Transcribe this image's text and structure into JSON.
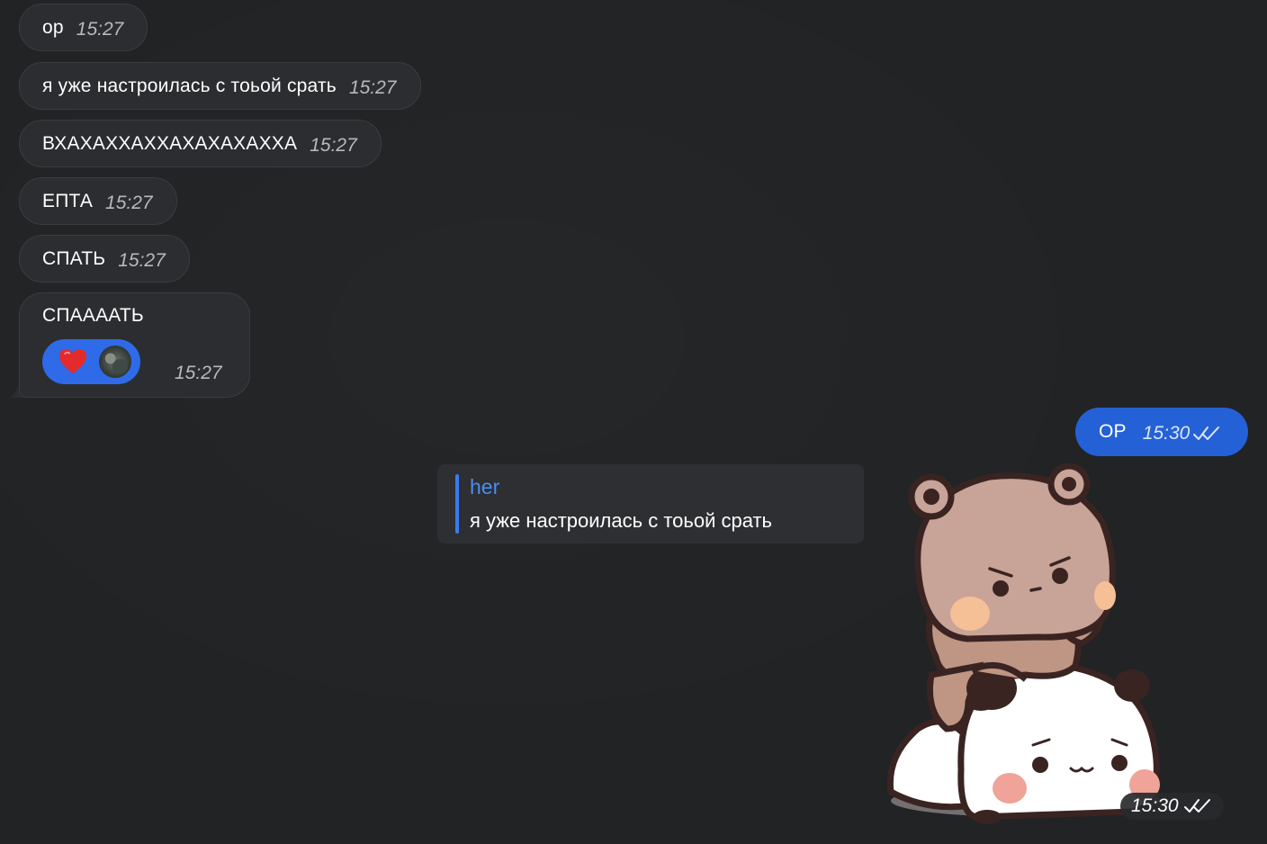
{
  "incoming": [
    {
      "text": "ор",
      "time": "15:27"
    },
    {
      "text": "я уже настроилась с тоьой срать",
      "time": "15:27"
    },
    {
      "text": "ВХАХАХХАХХАХАХАХАХХА",
      "time": "15:27"
    },
    {
      "text": "ЕПТА",
      "time": "15:27"
    },
    {
      "text": "СПАТЬ",
      "time": "15:27"
    },
    {
      "text": "СПААААТЬ",
      "time": "15:27",
      "reaction": {
        "emoji": "heart",
        "color": "#2f6be8"
      }
    }
  ],
  "outgoing": {
    "text": "ОР",
    "time": "15:30",
    "status": "read",
    "color": "#2561d6"
  },
  "reply": {
    "author": "her",
    "text": "я уже настроилась с тоьой срать",
    "accent": "#3a7cf0"
  },
  "sticker": {
    "name": "bear-and-panda-sticker",
    "time": "15:30",
    "status": "read"
  }
}
